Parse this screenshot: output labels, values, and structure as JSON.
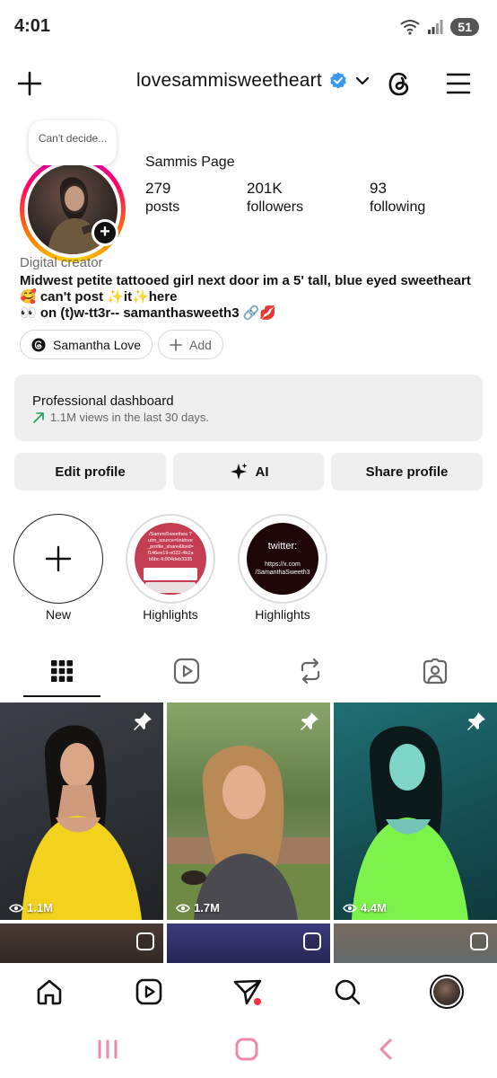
{
  "status_bar": {
    "time": "4:01",
    "battery": "51"
  },
  "header": {
    "username": "lovesammisweetheart"
  },
  "profile": {
    "note": "Can't decide...",
    "full_name": "Sammis Page",
    "stats": [
      {
        "num": "279",
        "label": "posts"
      },
      {
        "num": "201K",
        "label": "followers"
      },
      {
        "num": "93",
        "label": "following"
      }
    ],
    "category": "Digital creator",
    "bio_line1": "Midwest petite tattooed girl next door im a 5' tall, blue eyed sweetheart",
    "bio_line2": "🥰 can't post ✨it✨here",
    "bio_line3": "👀 on (t)w-tt3r-- samanthasweeth3 🔗💋",
    "threads_pill": "Samantha Love",
    "add_pill": "Add"
  },
  "dashboard": {
    "title": "Professional dashboard",
    "subtitle": "1.1M views in the last 30 days."
  },
  "actions": {
    "edit": "Edit profile",
    "ai": "AI",
    "share": "Share profile"
  },
  "highlights": [
    {
      "label": "New"
    },
    {
      "label": "Highlights",
      "cover_text": "/SammiSweethea ?utm_source=linktree _profile_share&ltsid= f146ee19-e022-4b2a b6bc-fc904deb3335"
    },
    {
      "label": "Highlights",
      "cover_title": "twitter:",
      "cover_text": "https://x.com /SamanthaSweeth3"
    }
  ],
  "grid": [
    {
      "views": "1.1M"
    },
    {
      "views": "1.7M"
    },
    {
      "views": "4.4M"
    }
  ],
  "icons": {
    "header": [
      "plus-icon",
      "verified-badge-icon",
      "chevron-down-icon",
      "threads-icon",
      "menu-icon"
    ],
    "tabs": [
      "grid-icon",
      "reels-icon",
      "reposts-icon",
      "tagged-icon"
    ],
    "nav": [
      "home-icon",
      "reels-icon",
      "send-icon",
      "search-icon",
      "profile-avatar"
    ]
  },
  "colors": {
    "accent_verified": "#3897f0",
    "notif_dot": "#ff3040",
    "pill_border": "#d8d8d8",
    "panel_bg": "#efefef"
  }
}
